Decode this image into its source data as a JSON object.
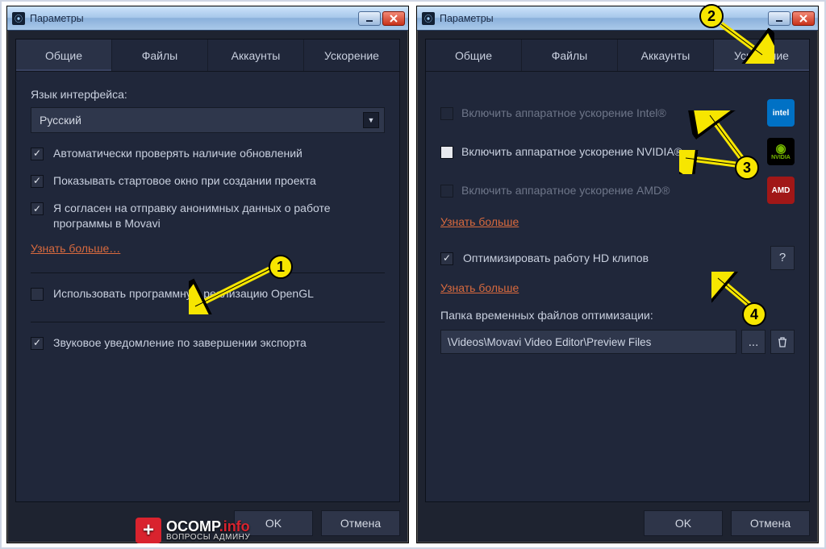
{
  "windowTitle": "Параметры",
  "tabs": {
    "general": "Общие",
    "files": "Файлы",
    "accounts": "Аккаунты",
    "accel": "Ускорение"
  },
  "left": {
    "langLabel": "Язык интерфейса:",
    "langValue": "Русский",
    "chk_updates": "Автоматически проверять наличие обновлений",
    "chk_startwin": "Показывать стартовое окно при создании проекта",
    "chk_anon": "Я согласен на отправку анонимных данных о работе программы в Movavi",
    "learn_more": "Узнать больше…",
    "chk_opengl": "Использовать программную реализацию OpenGL",
    "chk_sound": "Звуковое уведомление по завершении экспорта"
  },
  "right": {
    "chk_intel": "Включить аппаратное ускорение Intel®",
    "chk_nvidia": "Включить аппаратное ускорение NVIDIA®",
    "chk_amd": "Включить аппаратное ускорение AMD®",
    "learn_more": "Узнать больше",
    "chk_hd": "Оптимизировать работу HD клипов",
    "tmp_label": "Папка временных файлов оптимизации:",
    "tmp_path": "\\Videos\\Movavi Video Editor\\Preview Files"
  },
  "buttons": {
    "ok": "OK",
    "cancel": "Отмена"
  },
  "markers": {
    "m1": "1",
    "m2": "2",
    "m3": "3",
    "m4": "4"
  },
  "vendor": {
    "intel": "intel",
    "nvidia": "NVIDIA",
    "amd": "AMD"
  },
  "watermark": {
    "brand": "OCOMP",
    "tld": ".info",
    "sub": "ВОПРОСЫ АДМИНУ"
  },
  "glyphs": {
    "help": "?",
    "browse": "...",
    "trash": "🗑",
    "chevdown": "▼",
    "plus": "+"
  }
}
